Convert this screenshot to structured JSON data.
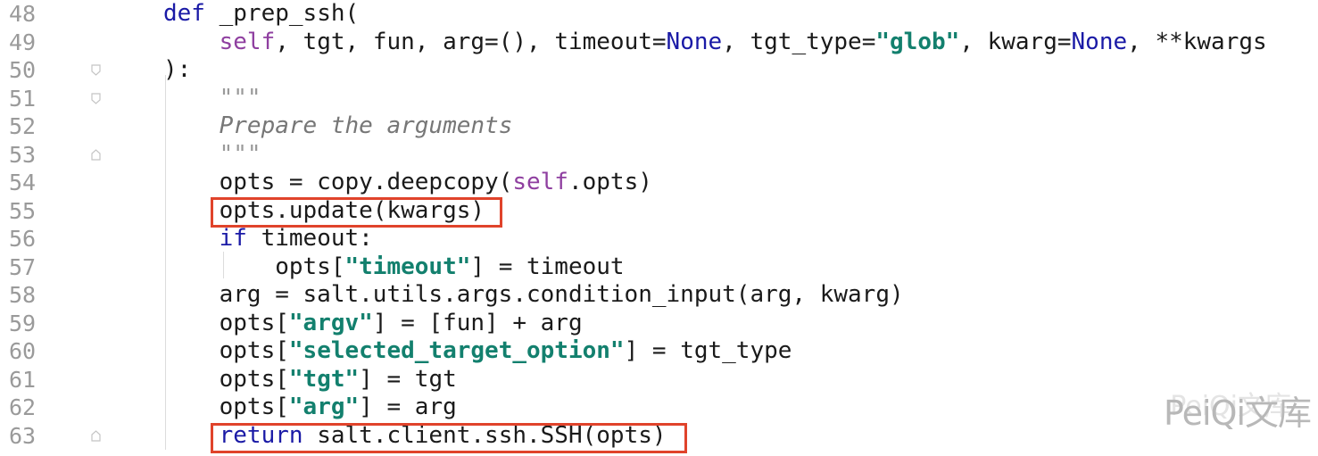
{
  "editor": {
    "language": "python",
    "colors": {
      "keyword": "#1a1aa6",
      "self": "#8f3fa0",
      "string": "#13806e",
      "docstring": "#777777",
      "line_number": "#9a9a9a",
      "highlight_box": "#e0432b"
    },
    "lines": [
      {
        "number": "48",
        "segments": [
          {
            "t": "kw",
            "v": "def"
          },
          {
            "t": "plain",
            "v": " _prep_ssh("
          }
        ]
      },
      {
        "number": "49",
        "segments": [
          {
            "t": "plain",
            "v": "    "
          },
          {
            "t": "self",
            "v": "self"
          },
          {
            "t": "plain",
            "v": ", tgt, fun, arg=(), timeout="
          },
          {
            "t": "none",
            "v": "None"
          },
          {
            "t": "plain",
            "v": ", tgt_type="
          },
          {
            "t": "str",
            "v": "\"glob\""
          },
          {
            "t": "plain",
            "v": ", kwarg="
          },
          {
            "t": "none",
            "v": "None"
          },
          {
            "t": "plain",
            "v": ", **kwargs"
          }
        ]
      },
      {
        "number": "50",
        "segments": [
          {
            "t": "plain",
            "v": "):"
          }
        ]
      },
      {
        "number": "51",
        "segments": [
          {
            "t": "plain",
            "v": "    "
          },
          {
            "t": "docq",
            "v": "\"\"\""
          }
        ]
      },
      {
        "number": "52",
        "segments": [
          {
            "t": "plain",
            "v": "    "
          },
          {
            "t": "doc",
            "v": "Prepare the arguments"
          }
        ]
      },
      {
        "number": "53",
        "segments": [
          {
            "t": "plain",
            "v": "    "
          },
          {
            "t": "docq",
            "v": "\"\"\""
          }
        ]
      },
      {
        "number": "54",
        "segments": [
          {
            "t": "plain",
            "v": "    opts = copy.deepcopy("
          },
          {
            "t": "self",
            "v": "self"
          },
          {
            "t": "plain",
            "v": ".opts)"
          }
        ]
      },
      {
        "number": "55",
        "segments": [
          {
            "t": "plain",
            "v": "    opts.update(kwargs)"
          }
        ]
      },
      {
        "number": "56",
        "segments": [
          {
            "t": "plain",
            "v": "    "
          },
          {
            "t": "kw",
            "v": "if"
          },
          {
            "t": "plain",
            "v": " timeout:"
          }
        ]
      },
      {
        "number": "57",
        "segments": [
          {
            "t": "plain",
            "v": "        opts["
          },
          {
            "t": "str",
            "v": "\"timeout\""
          },
          {
            "t": "plain",
            "v": "] = timeout"
          }
        ]
      },
      {
        "number": "58",
        "segments": [
          {
            "t": "plain",
            "v": "    arg = salt.utils.args.condition_input(arg, kwarg)"
          }
        ]
      },
      {
        "number": "59",
        "segments": [
          {
            "t": "plain",
            "v": "    opts["
          },
          {
            "t": "str",
            "v": "\"argv\""
          },
          {
            "t": "plain",
            "v": "] = [fun] + arg"
          }
        ]
      },
      {
        "number": "60",
        "segments": [
          {
            "t": "plain",
            "v": "    opts["
          },
          {
            "t": "str",
            "v": "\"selected_target_option\""
          },
          {
            "t": "plain",
            "v": "] = tgt_type"
          }
        ]
      },
      {
        "number": "61",
        "segments": [
          {
            "t": "plain",
            "v": "    opts["
          },
          {
            "t": "str",
            "v": "\"tgt\""
          },
          {
            "t": "plain",
            "v": "] = tgt"
          }
        ]
      },
      {
        "number": "62",
        "segments": [
          {
            "t": "plain",
            "v": "    opts["
          },
          {
            "t": "str",
            "v": "\"arg\""
          },
          {
            "t": "plain",
            "v": "] = arg"
          }
        ]
      },
      {
        "number": "63",
        "segments": [
          {
            "t": "plain",
            "v": "    "
          },
          {
            "t": "kw",
            "v": "return"
          },
          {
            "t": "plain",
            "v": " salt.client.ssh.SSH(opts)"
          }
        ]
      }
    ],
    "fold_markers": [
      {
        "line": "50",
        "icon": "fold-start-icon"
      },
      {
        "line": "51",
        "icon": "fold-start-icon"
      },
      {
        "line": "53",
        "icon": "fold-end-icon"
      },
      {
        "line": "63",
        "icon": "fold-end-icon"
      }
    ],
    "highlighted_lines": [
      "55",
      "63"
    ]
  },
  "watermark": {
    "text": "PeiQi文库",
    "shadow_text": "PeiQi文库"
  }
}
